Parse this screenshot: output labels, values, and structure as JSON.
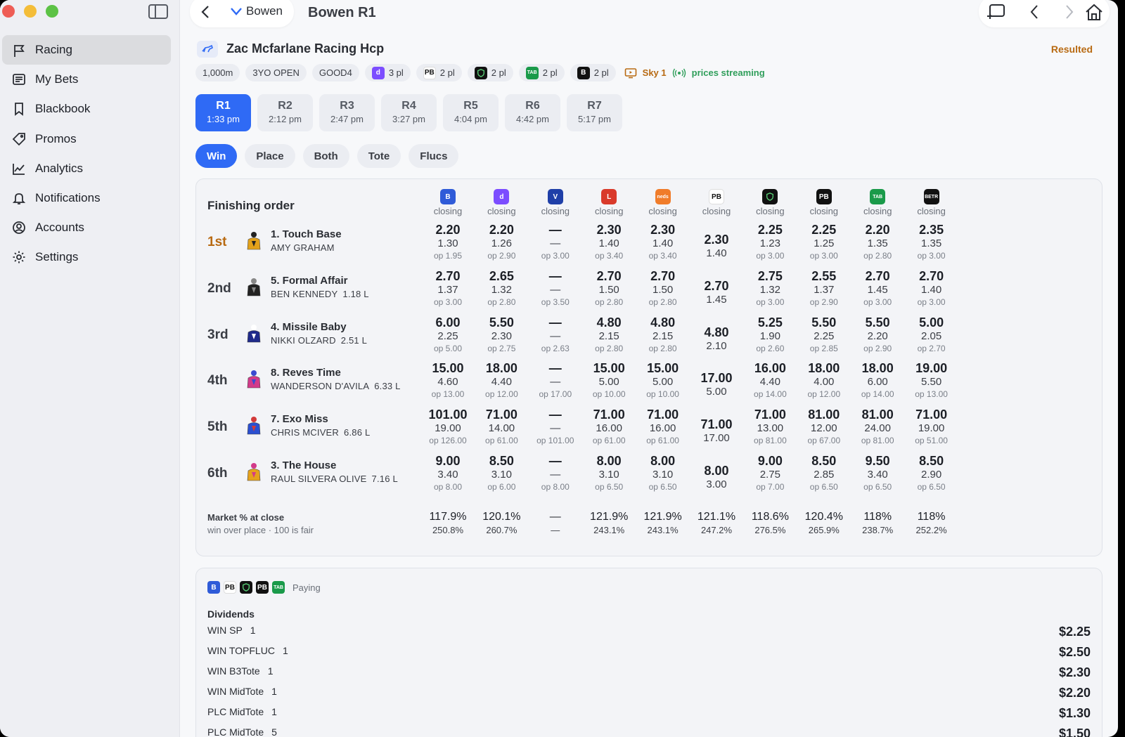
{
  "sidebar": {
    "items": [
      {
        "label": "Racing",
        "icon": "flag-icon",
        "active": true
      },
      {
        "label": "My Bets",
        "icon": "list-icon"
      },
      {
        "label": "Blackbook",
        "icon": "bookmark-icon"
      },
      {
        "label": "Promos",
        "icon": "tag-icon"
      },
      {
        "label": "Analytics",
        "icon": "chart-line-icon"
      },
      {
        "label": "Notifications",
        "icon": "bell-icon"
      },
      {
        "label": "Accounts",
        "icon": "user-circle-icon"
      },
      {
        "label": "Settings",
        "icon": "gear-icon"
      }
    ]
  },
  "topbar": {
    "venue": "Bowen",
    "title": "Bowen R1"
  },
  "race": {
    "name": "Zac Mcfarlane Racing Hcp",
    "status": "Resulted",
    "distance": "1,000m",
    "class": "3YO OPEN",
    "track": "GOOD4",
    "places": [
      {
        "logo": "dabble",
        "text": "3 pl",
        "color": "#7c4dff"
      },
      {
        "logo": "pb",
        "text": "2 pl",
        "color": "#ffffff"
      },
      {
        "logo": "shield",
        "text": "2 pl",
        "color": "#111111"
      },
      {
        "logo": "tab",
        "text": "2 pl",
        "color": "#1a9a4a"
      },
      {
        "logo": "betr",
        "text": "2 pl",
        "color": "#111111"
      }
    ],
    "channel": "Sky 1",
    "streaming": "prices streaming"
  },
  "race_tabs": [
    {
      "n": "R1",
      "t": "1:33 pm",
      "active": true
    },
    {
      "n": "R2",
      "t": "2:12 pm"
    },
    {
      "n": "R3",
      "t": "2:47 pm"
    },
    {
      "n": "R4",
      "t": "3:27 pm"
    },
    {
      "n": "R5",
      "t": "4:04 pm"
    },
    {
      "n": "R6",
      "t": "4:42 pm"
    },
    {
      "n": "R7",
      "t": "5:17 pm"
    }
  ],
  "market_tabs": [
    {
      "label": "Win",
      "active": true
    },
    {
      "label": "Place"
    },
    {
      "label": "Both"
    },
    {
      "label": "Tote"
    },
    {
      "label": "Flucs"
    }
  ],
  "results": {
    "title": "Finishing order",
    "bookmakers": [
      {
        "logo": "B",
        "color": "#2f5bd8",
        "label": "closing"
      },
      {
        "logo": "d",
        "color": "#7c4dff",
        "label": "closing"
      },
      {
        "logo": "V",
        "color": "#1f3fa8",
        "label": "closing"
      },
      {
        "logo": "L",
        "color": "#d93a2b",
        "label": "closing"
      },
      {
        "logo": "neds",
        "color": "#f07c2a",
        "label": "closing"
      },
      {
        "logo": "PB",
        "color": "#ffffff",
        "label": "closing"
      },
      {
        "logo": "S",
        "color": "#111111",
        "label": "closing"
      },
      {
        "logo": "PB",
        "color": "#111111",
        "label": "closing"
      },
      {
        "logo": "TAB",
        "color": "#1a9a4a",
        "label": "closing"
      },
      {
        "logo": "BETR",
        "color": "#111111",
        "label": "closing"
      }
    ],
    "runners": [
      {
        "place": "1st",
        "name": "1. Touch Base",
        "jockey": "AMY GRAHAM",
        "margin": "",
        "silk": [
          "#e2a11a",
          "#222222"
        ],
        "odds": [
          [
            "2.20",
            "1.30",
            "op 1.95"
          ],
          [
            "2.20",
            "1.26",
            "op 2.90"
          ],
          [
            "—",
            "—",
            "op 3.00"
          ],
          [
            "2.30",
            "1.40",
            "op 3.40"
          ],
          [
            "2.30",
            "1.40",
            "op 3.40"
          ],
          [
            "2.30",
            "1.40",
            ""
          ],
          [
            "2.25",
            "1.23",
            "op 3.00"
          ],
          [
            "2.25",
            "1.25",
            "op 3.00"
          ],
          [
            "2.20",
            "1.35",
            "op 2.80"
          ],
          [
            "2.35",
            "1.35",
            "op 3.00"
          ]
        ]
      },
      {
        "place": "2nd",
        "name": "5. Formal Affair",
        "jockey": "BEN KENNEDY",
        "margin": "1.18 L",
        "silk": [
          "#222222",
          "#888888"
        ],
        "odds": [
          [
            "2.70",
            "1.37",
            "op 3.00"
          ],
          [
            "2.65",
            "1.32",
            "op 2.80"
          ],
          [
            "—",
            "—",
            "op 3.50"
          ],
          [
            "2.70",
            "1.50",
            "op 2.80"
          ],
          [
            "2.70",
            "1.50",
            "op 2.80"
          ],
          [
            "2.70",
            "1.45",
            ""
          ],
          [
            "2.75",
            "1.32",
            "op 3.00"
          ],
          [
            "2.55",
            "1.37",
            "op 2.90"
          ],
          [
            "2.70",
            "1.45",
            "op 3.00"
          ],
          [
            "2.70",
            "1.40",
            "op 3.00"
          ]
        ]
      },
      {
        "place": "3rd",
        "name": "4. Missile Baby",
        "jockey": "NIKKI OLZARD",
        "margin": "2.51 L",
        "silk": [
          "#1f2a8a",
          "#ffffff"
        ],
        "odds": [
          [
            "6.00",
            "2.25",
            "op 5.00"
          ],
          [
            "5.50",
            "2.30",
            "op 2.75"
          ],
          [
            "—",
            "—",
            "op 2.63"
          ],
          [
            "4.80",
            "2.15",
            "op 2.80"
          ],
          [
            "4.80",
            "2.15",
            "op 2.80"
          ],
          [
            "4.80",
            "2.10",
            ""
          ],
          [
            "5.25",
            "1.90",
            "op 2.60"
          ],
          [
            "5.50",
            "2.25",
            "op 2.85"
          ],
          [
            "5.50",
            "2.20",
            "op 2.90"
          ],
          [
            "5.00",
            "2.05",
            "op 2.70"
          ]
        ]
      },
      {
        "place": "4th",
        "name": "8. Reves Time",
        "jockey": "WANDERSON D'AVILA",
        "margin": "6.33 L",
        "silk": [
          "#d23a8a",
          "#3a4ad0"
        ],
        "odds": [
          [
            "15.00",
            "4.60",
            "op 13.00"
          ],
          [
            "18.00",
            "4.40",
            "op 12.00"
          ],
          [
            "—",
            "—",
            "op 17.00"
          ],
          [
            "15.00",
            "5.00",
            "op 10.00"
          ],
          [
            "15.00",
            "5.00",
            "op 10.00"
          ],
          [
            "17.00",
            "5.00",
            ""
          ],
          [
            "16.00",
            "4.40",
            "op 14.00"
          ],
          [
            "18.00",
            "4.00",
            "op 12.00"
          ],
          [
            "18.00",
            "6.00",
            "op 14.00"
          ],
          [
            "19.00",
            "5.50",
            "op 13.00"
          ]
        ]
      },
      {
        "place": "5th",
        "name": "7. Exo Miss",
        "jockey": "CHRIS MCIVER",
        "margin": "6.86 L",
        "silk": [
          "#2a4fd0",
          "#d23a3a"
        ],
        "odds": [
          [
            "101.00",
            "19.00",
            "op 126.00"
          ],
          [
            "71.00",
            "14.00",
            "op 61.00"
          ],
          [
            "—",
            "—",
            "op 101.00"
          ],
          [
            "71.00",
            "16.00",
            "op 61.00"
          ],
          [
            "71.00",
            "16.00",
            "op 61.00"
          ],
          [
            "71.00",
            "17.00",
            ""
          ],
          [
            "71.00",
            "13.00",
            "op 81.00"
          ],
          [
            "81.00",
            "12.00",
            "op 67.00"
          ],
          [
            "81.00",
            "24.00",
            "op 81.00"
          ],
          [
            "71.00",
            "19.00",
            "op 51.00"
          ]
        ]
      },
      {
        "place": "6th",
        "name": "3. The House",
        "jockey": "RAUL SILVERA OLIVE",
        "margin": "7.16 L",
        "silk": [
          "#e6a21c",
          "#d23a8a"
        ],
        "odds": [
          [
            "9.00",
            "3.40",
            "op 8.00"
          ],
          [
            "8.50",
            "3.10",
            "op 6.00"
          ],
          [
            "—",
            "—",
            "op 8.00"
          ],
          [
            "8.00",
            "3.10",
            "op 6.50"
          ],
          [
            "8.00",
            "3.10",
            "op 6.50"
          ],
          [
            "8.00",
            "3.00",
            ""
          ],
          [
            "9.00",
            "2.75",
            "op 7.00"
          ],
          [
            "8.50",
            "2.85",
            "op 6.50"
          ],
          [
            "9.50",
            "3.40",
            "op 6.50"
          ],
          [
            "8.50",
            "2.90",
            "op 6.50"
          ]
        ]
      }
    ],
    "market": {
      "label": "Market % at close",
      "sub": "win over place · 100 is fair",
      "values": [
        [
          "117.9%",
          "250.8%"
        ],
        [
          "120.1%",
          "260.7%"
        ],
        [
          "—",
          "—"
        ],
        [
          "121.9%",
          "243.1%"
        ],
        [
          "121.9%",
          "243.1%"
        ],
        [
          "121.1%",
          "247.2%"
        ],
        [
          "118.6%",
          "276.5%"
        ],
        [
          "120.4%",
          "265.9%"
        ],
        [
          "118%",
          "238.7%"
        ],
        [
          "118%",
          "252.2%"
        ]
      ]
    }
  },
  "dividends": {
    "paying_label": "Paying",
    "paying_logos": [
      {
        "logo": "B",
        "color": "#2f5bd8"
      },
      {
        "logo": "PB",
        "color": "#ffffff"
      },
      {
        "logo": "S",
        "color": "#111111"
      },
      {
        "logo": "PB",
        "color": "#111111"
      },
      {
        "logo": "TAB",
        "color": "#1a9a4a"
      }
    ],
    "title": "Dividends",
    "rows": [
      {
        "label": "WIN SP",
        "runner": "1",
        "amount": "$2.25"
      },
      {
        "label": "WIN TOPFLUC",
        "runner": "1",
        "amount": "$2.50"
      },
      {
        "label": "WIN B3Tote",
        "runner": "1",
        "amount": "$2.30"
      },
      {
        "label": "WIN MidTote",
        "runner": "1",
        "amount": "$2.20"
      },
      {
        "label": "PLC MidTote",
        "runner": "1",
        "amount": "$1.30"
      },
      {
        "label": "PLC MidTote",
        "runner": "5",
        "amount": "$1.50"
      }
    ]
  }
}
